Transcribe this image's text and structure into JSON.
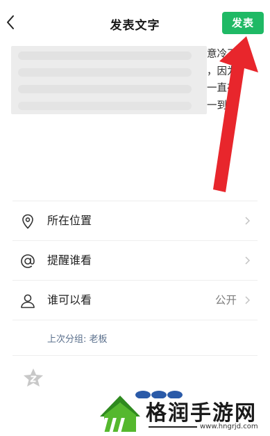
{
  "header": {
    "back_icon": "chevron-left-icon",
    "title": "发表文字",
    "publish_label": "发表",
    "accent_color": "#1fb965"
  },
  "post": {
    "text_fragments": "意冷了\n，因为\n一直在\n一到"
  },
  "menu": {
    "items": [
      {
        "icon": "location-pin-icon",
        "label": "所在位置",
        "value": ""
      },
      {
        "icon": "at-sign-icon",
        "label": "提醒谁看",
        "value": ""
      },
      {
        "icon": "person-icon",
        "label": "谁可以看",
        "value": "公开"
      }
    ],
    "last_group_hint": "上次分组: 老板"
  },
  "footer": {
    "sticker_icon": "star-sticker-icon"
  },
  "watermark": {
    "name": "格润手游网",
    "url": "www.hngrjd.com"
  },
  "annotation": {
    "arrow_color": "#e8262c"
  }
}
